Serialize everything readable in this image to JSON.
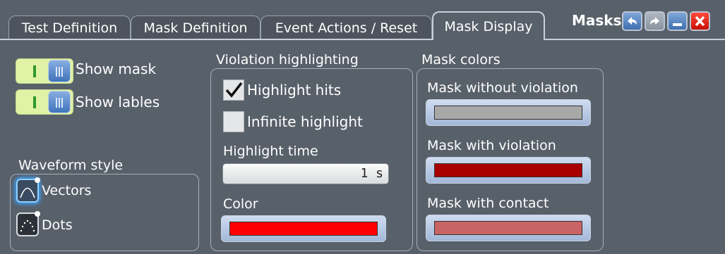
{
  "tabs": [
    {
      "label": "Test Definition"
    },
    {
      "label": "Mask Definition"
    },
    {
      "label": "Event Actions / Reset"
    },
    {
      "label": "Mask Display"
    }
  ],
  "window": {
    "title": "Masks"
  },
  "display": {
    "show_mask": {
      "label": "Show mask",
      "on": true
    },
    "show_labels": {
      "label": "Show lables",
      "on": true
    }
  },
  "waveform_style": {
    "title": "Waveform style",
    "options": [
      {
        "label": "Vectors",
        "selected": true,
        "icon": "vectors-icon"
      },
      {
        "label": "Dots",
        "selected": false,
        "icon": "dots-icon"
      }
    ]
  },
  "violation": {
    "title": "Violation highlighting",
    "highlight_hits": {
      "label": "Highlight hits",
      "checked": true
    },
    "infinite_highlight": {
      "label": "Infinite highlight",
      "checked": false
    },
    "highlight_time": {
      "label": "Highlight time",
      "value": "1 s"
    },
    "color": {
      "label": "Color",
      "value": "#ff0000"
    }
  },
  "mask_colors": {
    "title": "Mask colors",
    "items": [
      {
        "label": "Mask without violation",
        "color": "#a8a8a8"
      },
      {
        "label": "Mask with violation",
        "color": "#a80000"
      },
      {
        "label": "Mask with contact",
        "color": "#c86464"
      }
    ]
  }
}
